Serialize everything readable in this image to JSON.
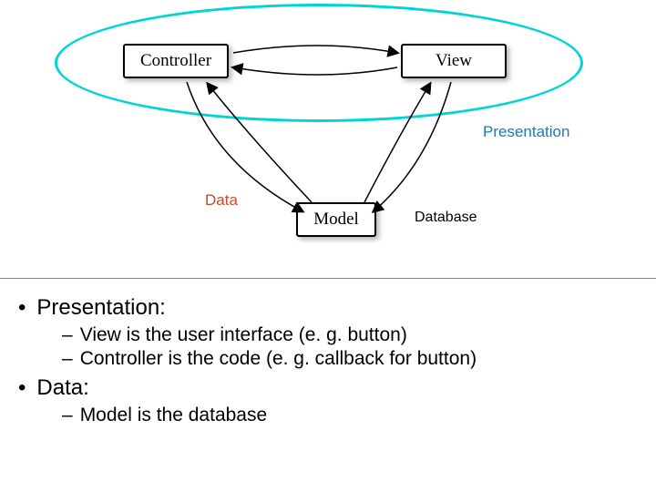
{
  "diagram": {
    "boxes": {
      "controller": "Controller",
      "view": "View",
      "model": "Model"
    },
    "labels": {
      "presentation": "Presentation",
      "data": "Data",
      "database": "Database"
    }
  },
  "text": {
    "bullet1": "Presentation:",
    "sub1a": "View is the user interface (e. g. button)",
    "sub1b": "Controller is the code (e. g. callback for button)",
    "bullet2": "Data:",
    "sub2a": "Model is the database"
  }
}
